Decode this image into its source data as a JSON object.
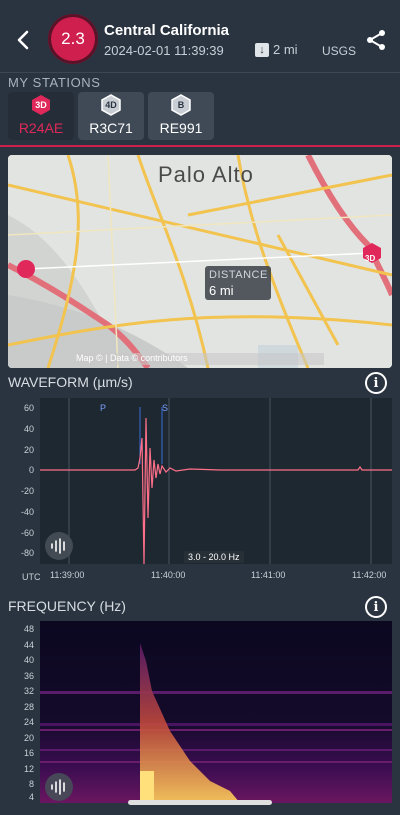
{
  "header": {
    "magnitude": "2.3",
    "title": "Central California",
    "datetime": "2024-02-01 11:39:39",
    "distance": "2 mi",
    "source": "USGS"
  },
  "stations": {
    "label": "MY STATIONS",
    "items": [
      {
        "badge": "3D",
        "name": "R24AE",
        "selected": true
      },
      {
        "badge": "4D",
        "name": "R3C71",
        "selected": false
      },
      {
        "badge": "B",
        "name": "RE991",
        "selected": false
      }
    ]
  },
  "map": {
    "place_label": "Palo Alto",
    "distance_label": "DISTANCE",
    "distance_value": "6 mi",
    "station_badge": "3D",
    "attribution": "Map © | Data © contributors"
  },
  "waveform": {
    "label": "WAVEFORM (µm/s)",
    "y_ticks": [
      "60",
      "40",
      "20",
      "0",
      "-20",
      "-40",
      "-60",
      "-80"
    ],
    "x_unit": "UTC",
    "x_ticks": [
      "11:39:00",
      "11:40:00",
      "11:41:00",
      "11:42:00"
    ],
    "p_label": "P",
    "s_label": "S",
    "band": "3.0 - 20.0 Hz"
  },
  "frequency": {
    "label": "FREQUENCY (Hz)",
    "y_ticks": [
      "48",
      "44",
      "40",
      "36",
      "32",
      "28",
      "24",
      "20",
      "16",
      "12",
      "8",
      "4"
    ]
  },
  "colors": {
    "accent": "#cf1f4f",
    "background": "#2a3440",
    "waveform_line": "#ff6f8a"
  }
}
